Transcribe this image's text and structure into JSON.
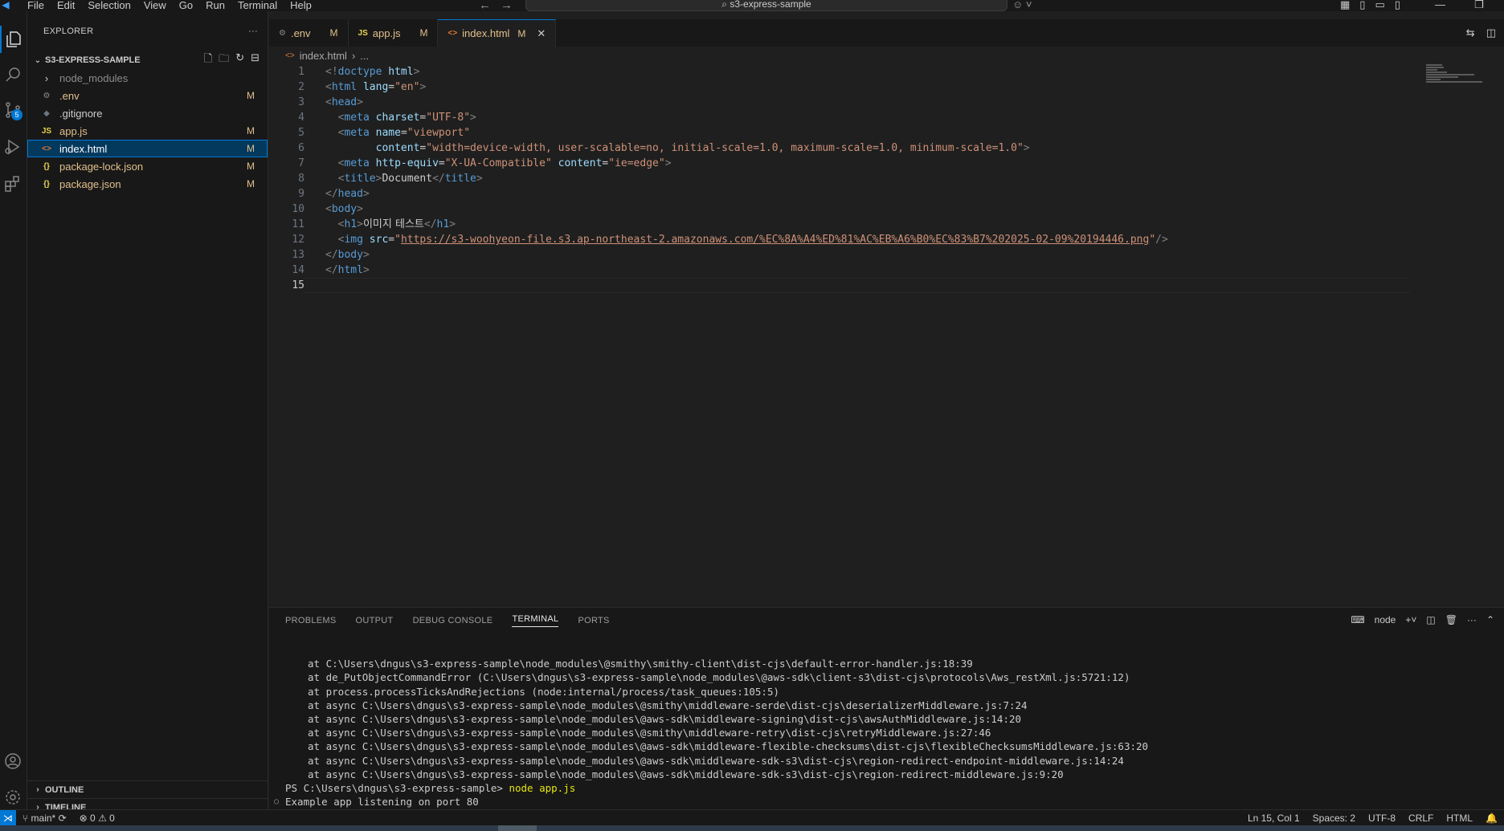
{
  "menu": [
    "File",
    "Edit",
    "Selection",
    "View",
    "Go",
    "Run",
    "Terminal",
    "Help"
  ],
  "search": {
    "text": "s3-express-sample"
  },
  "sidebar": {
    "title": "EXPLORER",
    "folder": "S3-EXPRESS-SAMPLE",
    "files": [
      {
        "name": "node_modules",
        "icon": "›",
        "status": ""
      },
      {
        "name": ".env",
        "icon": "⚙",
        "status": "M"
      },
      {
        "name": ".gitignore",
        "icon": "◆",
        "status": ""
      },
      {
        "name": "app.js",
        "icon": "JS",
        "status": "M"
      },
      {
        "name": "index.html",
        "icon": "<>",
        "status": "M"
      },
      {
        "name": "package-lock.json",
        "icon": "{}",
        "status": "M"
      },
      {
        "name": "package.json",
        "icon": "{}",
        "status": "M"
      }
    ],
    "outline": "OUTLINE",
    "timeline": "TIMELINE",
    "scm_badge": "5"
  },
  "tabs": [
    {
      "label": ".env",
      "icon": "⚙",
      "status": "M"
    },
    {
      "label": "app.js",
      "icon": "JS",
      "status": "M"
    },
    {
      "label": "index.html",
      "icon": "<>",
      "status": "M"
    }
  ],
  "breadcrumb": {
    "file": "index.html",
    "rest": "..."
  },
  "editor": {
    "line_numbers": [
      "1",
      "2",
      "3",
      "4",
      "5",
      "6",
      "7",
      "8",
      "9",
      "10",
      "11",
      "12",
      "13",
      "14",
      "15"
    ],
    "h1_text": "이미지 테스트",
    "img_src": "https://s3-woohyeon-file.s3.ap-northeast-2.amazonaws.com/%EC%8A%A4%ED%81%AC%EB%A6%B0%EC%83%B7%202025-02-09%20194446.png",
    "viewport_content": "width=device-width, user-scalable=no, initial-scale=1.0, maximum-scale=1.0, minimum-scale=1.0",
    "title_text": "Document"
  },
  "panel": {
    "tabs": [
      "PROBLEMS",
      "OUTPUT",
      "DEBUG CONSOLE",
      "TERMINAL",
      "PORTS"
    ],
    "shell": "node",
    "terminal_lines": [
      "at C:\\Users\\dngus\\s3-express-sample\\node_modules\\@smithy\\smithy-client\\dist-cjs\\default-error-handler.js:18:39",
      "at de_PutObjectCommandError (C:\\Users\\dngus\\s3-express-sample\\node_modules\\@aws-sdk\\client-s3\\dist-cjs\\protocols\\Aws_restXml.js:5721:12)",
      "at process.processTicksAndRejections (node:internal/process/task_queues:105:5)",
      "at async C:\\Users\\dngus\\s3-express-sample\\node_modules\\@smithy\\middleware-serde\\dist-cjs\\deserializerMiddleware.js:7:24",
      "at async C:\\Users\\dngus\\s3-express-sample\\node_modules\\@aws-sdk\\middleware-signing\\dist-cjs\\awsAuthMiddleware.js:14:20",
      "at async C:\\Users\\dngus\\s3-express-sample\\node_modules\\@smithy\\middleware-retry\\dist-cjs\\retryMiddleware.js:27:46",
      "at async C:\\Users\\dngus\\s3-express-sample\\node_modules\\@aws-sdk\\middleware-flexible-checksums\\dist-cjs\\flexibleChecksumsMiddleware.js:63:20",
      "at async C:\\Users\\dngus\\s3-express-sample\\node_modules\\@aws-sdk\\middleware-sdk-s3\\dist-cjs\\region-redirect-endpoint-middleware.js:14:24",
      "at async C:\\Users\\dngus\\s3-express-sample\\node_modules\\@aws-sdk\\middleware-sdk-s3\\dist-cjs\\region-redirect-middleware.js:9:20"
    ],
    "prompt": "PS C:\\Users\\dngus\\s3-express-sample>",
    "command": "node app.js",
    "output": "Example app listening on port 80"
  },
  "status": {
    "branch": "main*",
    "errors": "0",
    "warnings": "0",
    "position": "Ln 15, Col 1",
    "spaces": "Spaces: 2",
    "encoding": "UTF-8",
    "eol": "CRLF",
    "language": "HTML"
  }
}
